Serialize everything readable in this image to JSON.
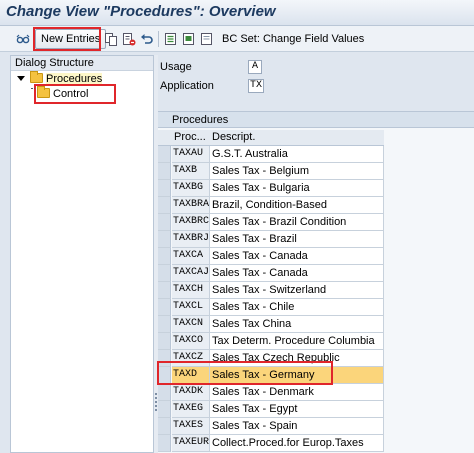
{
  "title": "Change View \"Procedures\": Overview",
  "toolbar": {
    "new_entries": "New Entries",
    "bc_set": "BC Set: Change Field Values"
  },
  "dialog_structure": {
    "header": "Dialog Structure",
    "items": [
      {
        "label": "Procedures"
      },
      {
        "label": "Control"
      }
    ]
  },
  "fields": {
    "usage_label": "Usage",
    "usage_value": "A",
    "application_label": "Application",
    "application_value": "TX"
  },
  "procedures": {
    "title": "Procedures",
    "columns": [
      "Proc...",
      "Descript."
    ],
    "rows": [
      {
        "code": "TAXAU",
        "desc": "G.S.T.  Australia"
      },
      {
        "code": "TAXB",
        "desc": "Sales Tax - Belgium"
      },
      {
        "code": "TAXBG",
        "desc": "Sales Tax - Bulgaria"
      },
      {
        "code": "TAXBRA",
        "desc": "Brazil, Condition-Based"
      },
      {
        "code": "TAXBRC",
        "desc": "Sales Tax - Brazil Condition"
      },
      {
        "code": "TAXBRJ",
        "desc": "Sales Tax - Brazil"
      },
      {
        "code": "TAXCA",
        "desc": "Sales Tax - Canada"
      },
      {
        "code": "TAXCAJ",
        "desc": "Sales Tax - Canada"
      },
      {
        "code": "TAXCH",
        "desc": "Sales Tax - Switzerland"
      },
      {
        "code": "TAXCL",
        "desc": "Sales Tax - Chile"
      },
      {
        "code": "TAXCN",
        "desc": "Sales Tax China"
      },
      {
        "code": "TAXCO",
        "desc": "Tax Determ. Procedure Columbia"
      },
      {
        "code": "TAXCZ",
        "desc": "Sales Tax Czech Republic"
      },
      {
        "code": "TAXD",
        "desc": "Sales Tax - Germany"
      },
      {
        "code": "TAXDK",
        "desc": "Sales Tax - Denmark"
      },
      {
        "code": "TAXEG",
        "desc": "Sales Tax - Egypt"
      },
      {
        "code": "TAXES",
        "desc": "Sales Tax - Spain"
      },
      {
        "code": "TAXEUR",
        "desc": "Collect.Proced.for Europ.Taxes"
      }
    ]
  },
  "colors": {
    "highlight": "#fbd57b",
    "annotation": "#e0262b"
  }
}
